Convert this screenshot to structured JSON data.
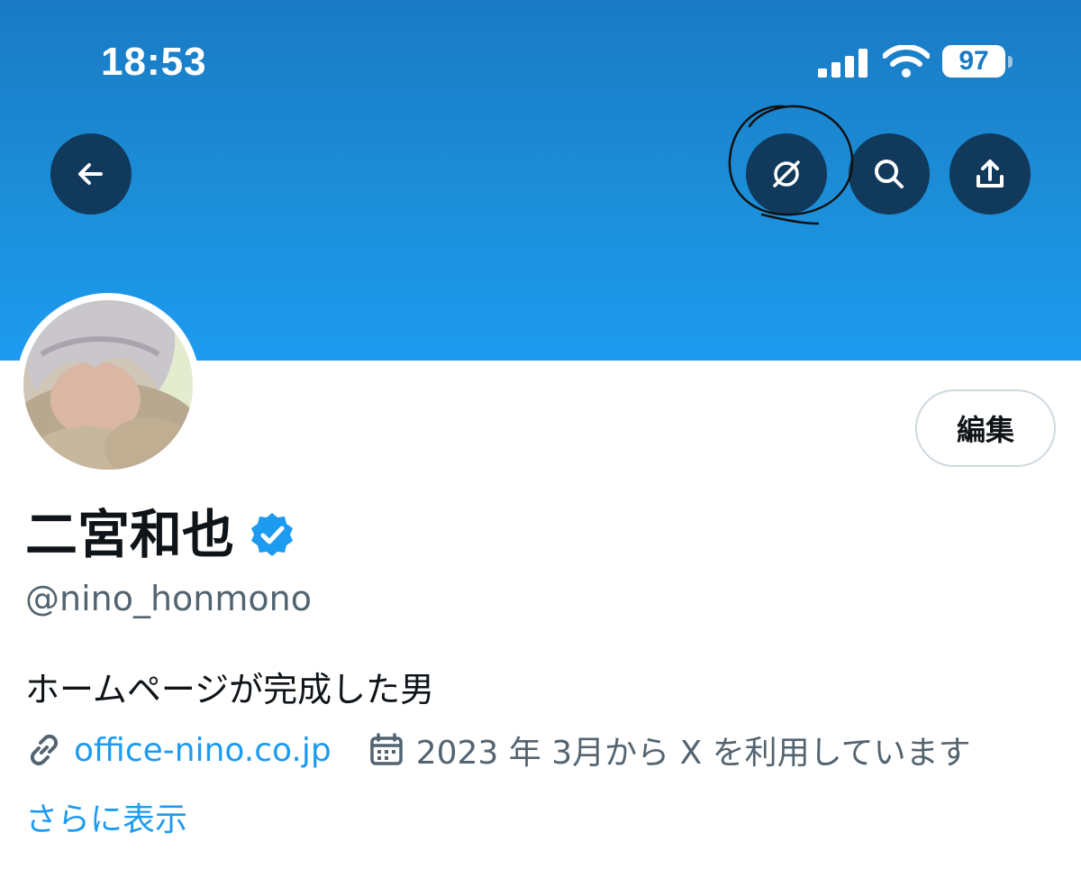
{
  "status_bar": {
    "time": "18:53",
    "battery_level": "97",
    "icons": [
      "cellular-signal-icon",
      "wifi-icon",
      "battery-icon"
    ]
  },
  "header": {
    "banner_color": "#1d9bf0",
    "buttons": {
      "back": "back-arrow-icon",
      "grok": "grok-slash-icon",
      "search": "search-icon",
      "share": "share-icon"
    }
  },
  "profile": {
    "display_name": "二宮和也",
    "verified_icon": "verified-badge-icon",
    "handle": "@nino_honmono",
    "bio": "ホームページが完成した男",
    "website": "office-nino.co.jp",
    "joined": "2023 年 3月から X を利用しています",
    "show_more": "さらに表示",
    "edit_button": "編集"
  },
  "colors": {
    "accent": "#1d9bf0",
    "text_primary": "#0f1419",
    "text_secondary": "#536471",
    "border": "#cfd9de"
  }
}
